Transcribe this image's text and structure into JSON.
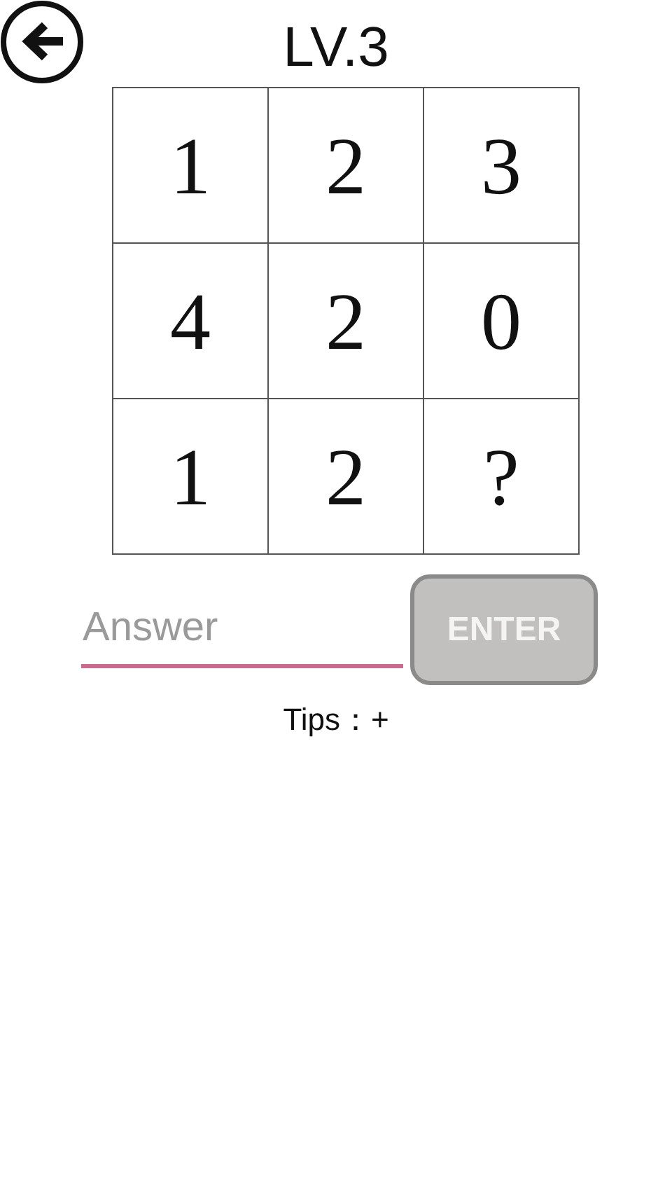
{
  "title": "LV.3",
  "grid": [
    [
      "1",
      "2",
      "3"
    ],
    [
      "4",
      "2",
      "0"
    ],
    [
      "1",
      "2",
      "?"
    ]
  ],
  "answer": {
    "placeholder": "Answer"
  },
  "enter_button": {
    "label": "ENTER",
    "disabled": true
  },
  "tips": "Tips：+"
}
